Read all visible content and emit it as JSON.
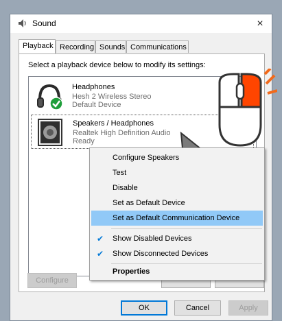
{
  "window": {
    "title": "Sound",
    "close_symbol": "×"
  },
  "tabs": [
    {
      "label": "Playback",
      "active": true
    },
    {
      "label": "Recording",
      "active": false
    },
    {
      "label": "Sounds",
      "active": false
    },
    {
      "label": "Communications",
      "active": false
    }
  ],
  "instruction": "Select a playback device below to modify its settings:",
  "devices": [
    {
      "name": "Headphones",
      "description": "Hesh 2 Wireless Stereo",
      "status": "Default Device",
      "icon": "headphones-icon",
      "badge": "green-check-badge"
    },
    {
      "name": "Speakers / Headphones",
      "description": "Realtek High Definition Audio",
      "status": "Ready",
      "icon": "speaker-icon"
    }
  ],
  "context_menu": {
    "items": [
      {
        "label": "Configure Speakers",
        "checked": false,
        "highlighted": false,
        "bold": false
      },
      {
        "label": "Test",
        "checked": false,
        "highlighted": false,
        "bold": false
      },
      {
        "label": "Disable",
        "checked": false,
        "highlighted": false,
        "bold": false
      },
      {
        "label": "Set as Default Device",
        "checked": false,
        "highlighted": false,
        "bold": false
      },
      {
        "label": "Set as Default Communication Device",
        "checked": false,
        "highlighted": true,
        "bold": false
      },
      {
        "label": "Show Disabled Devices",
        "checked": true,
        "highlighted": false,
        "bold": false
      },
      {
        "label": "Show Disconnected Devices",
        "checked": true,
        "highlighted": false,
        "bold": false
      },
      {
        "label": "Properties",
        "checked": false,
        "highlighted": false,
        "bold": true
      }
    ]
  },
  "buttons": {
    "configure": "Configure",
    "ok": "OK",
    "cancel": "Cancel",
    "apply": "Apply"
  },
  "colors": {
    "highlight": "#91c9f7",
    "check": "#0078d7",
    "mouse_button": "#ff4500",
    "arrow": "#f26a1b",
    "default_badge": "#1e9e3a"
  },
  "overlay": {
    "mouse_icon": "mouse-right-click-icon",
    "cursor_icon": "pointer-cursor-icon"
  }
}
